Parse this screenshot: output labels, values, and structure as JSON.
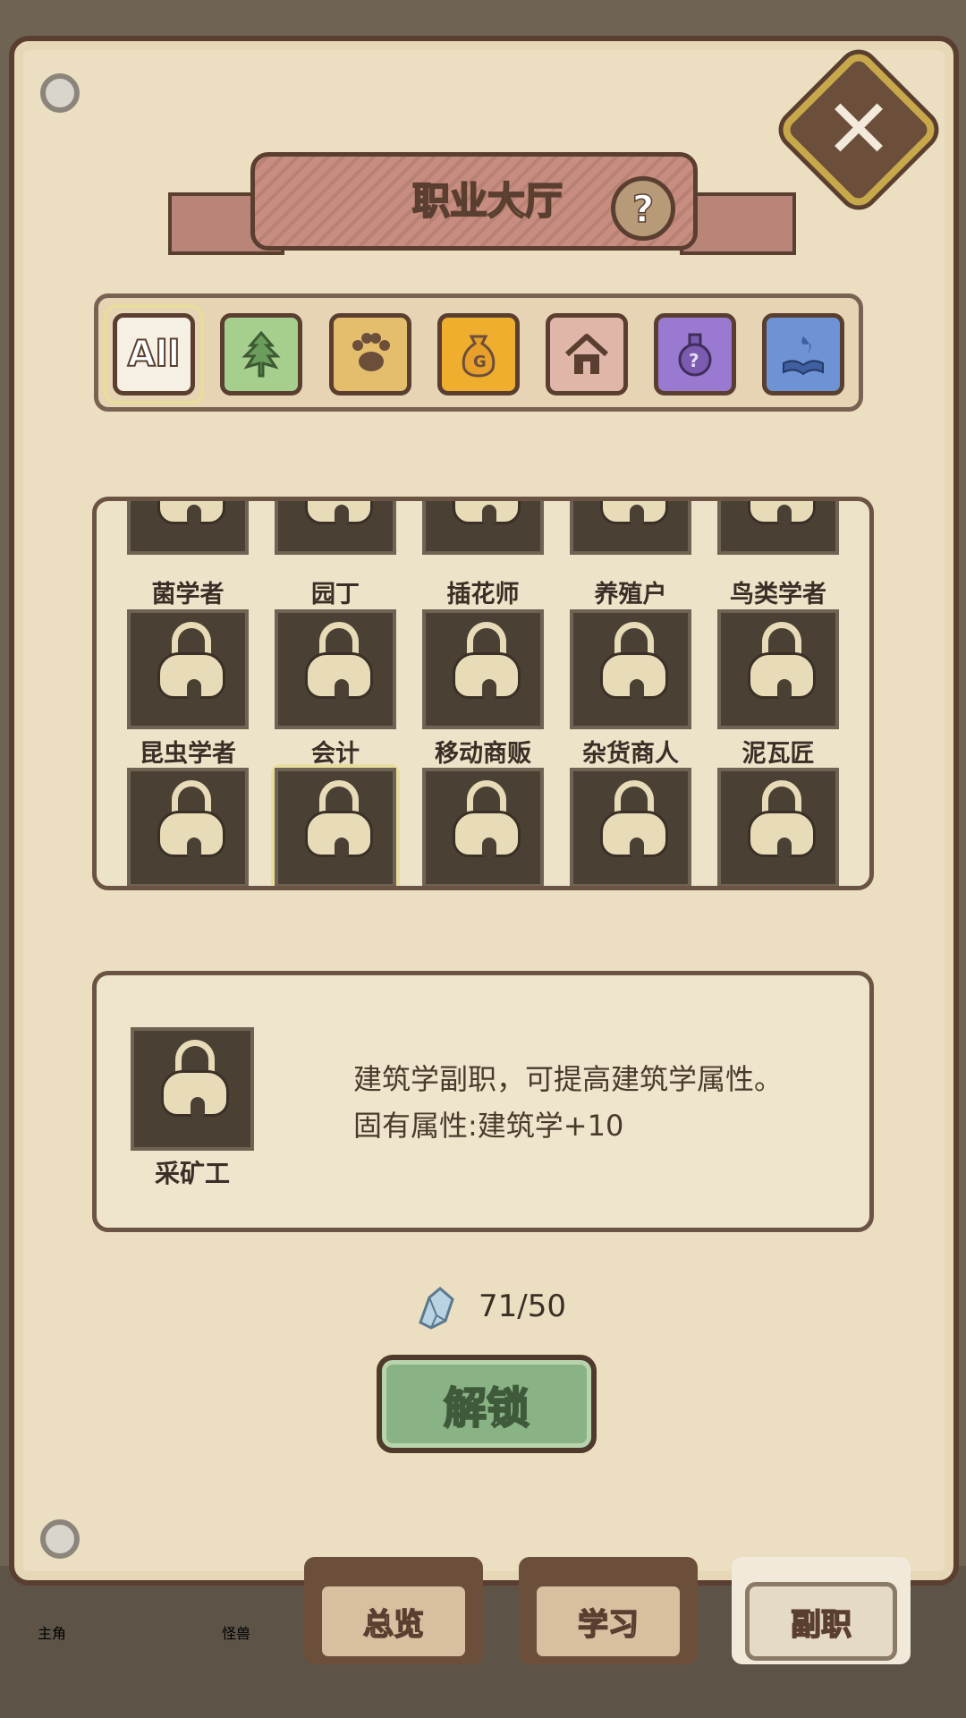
{
  "title": "职业大厅",
  "help_icon": "question-icon",
  "close_icon": "close-icon",
  "categories": [
    {
      "label": "All",
      "icon": "all-icon",
      "color": "#f5efe4"
    },
    {
      "label": "",
      "icon": "leaf-icon",
      "color": "#a6cf8e"
    },
    {
      "label": "",
      "icon": "paw-icon",
      "color": "#e5be6d"
    },
    {
      "label": "",
      "icon": "money-bag-icon",
      "color": "#f0ae2f"
    },
    {
      "label": "",
      "icon": "house-icon",
      "color": "#e0b6a9"
    },
    {
      "label": "",
      "icon": "potion-icon",
      "color": "#9a7ad0"
    },
    {
      "label": "",
      "icon": "book-flame-icon",
      "color": "#6d93d4"
    }
  ],
  "jobs_row1": [
    "菌学者",
    "园丁",
    "插花师",
    "养殖户",
    "鸟类学者"
  ],
  "jobs_row2": [
    "昆虫学者",
    "会计",
    "移动商贩",
    "杂货商人",
    "泥瓦匠"
  ],
  "detail": {
    "name": "采矿工",
    "description_line1": "建筑学副职，可提高建筑学属性。",
    "description_line2": "固有属性:建筑学+10"
  },
  "cost": {
    "icon": "crystal-icon",
    "text": "71/50"
  },
  "unlock_label": "解锁",
  "bottom_tabs": [
    {
      "label": "总览",
      "active": false
    },
    {
      "label": "学习",
      "active": false
    },
    {
      "label": "副职",
      "active": true
    }
  ],
  "background_hud": [
    "主角",
    "怪兽"
  ]
}
